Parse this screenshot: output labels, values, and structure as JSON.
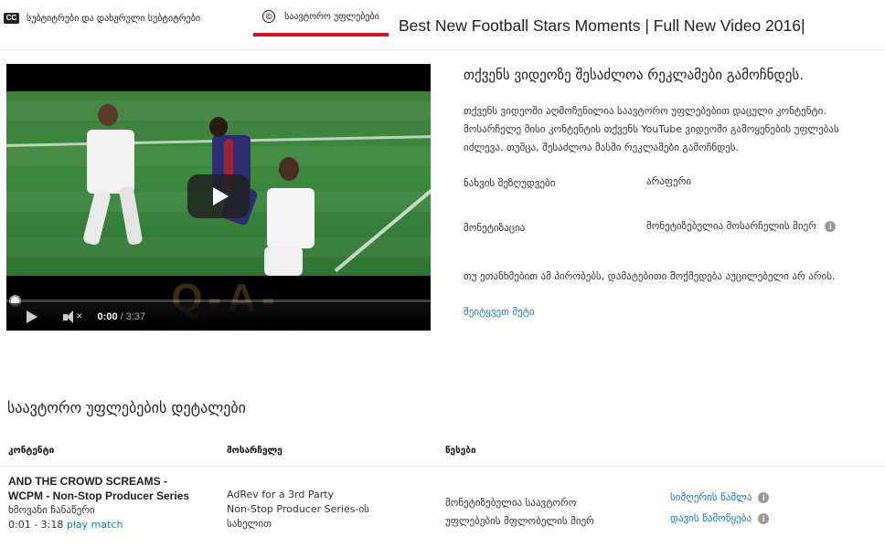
{
  "tabs": {
    "cc_badge": "CC",
    "subtitles_label": "სუბტიტრები და დახურული სუბტიტრები",
    "copyright_symbol": "©",
    "copyright_label": "საავტორო უფლებები"
  },
  "video_title": "Best New Football Stars Moments | Full New Video 2016|",
  "player": {
    "watermark": "Q-A-STUDIO",
    "current_time": "0:00",
    "separator": " / ",
    "duration": "3:37",
    "progress_fraction": 0.0
  },
  "info": {
    "heading": "თქვენს ვიდეოზე შესაძლოა რეკლამები გამოჩნდეს.",
    "paragraph": "თქვენს ვიდეოში აღმოჩენილია საავტორო უფლებებით დაცული კონტენტი. მოსარჩელე მისი კონტენტის თქვენს YouTube ვიდეოში გამოყენების უფლებას იძლევა. თუმცა, შესაძლოა მასში რეკლამები გამოჩნდეს.",
    "restrictions_label": "ნახვის შეზღუდვები",
    "restrictions_value": "არაფერი",
    "monetization_label": "მონეტიზაცია",
    "monetization_value": "მონეტიზებულია მოსარჩელის მიერ",
    "agree_text": "თუ ეთანხმებით ამ პირობებს, დამატებითი მოქმედება აუცილებელი არ არის.",
    "learn_more": "შეიტყვეთ მეტი"
  },
  "details": {
    "heading": "საავტორო უფლებების დეტალები",
    "columns": [
      "კონტენტი",
      "მოსარჩელე",
      "წესები"
    ],
    "row": {
      "content_title": "AND THE CROWD SCREAMS - WCPM - Non-Stop Producer Series",
      "content_type": "ხმოვანი ჩანაწერი",
      "time_range": "0:01 - 3:18",
      "play_match": "play match",
      "claimant": "AdRev for a 3rd Party",
      "claimant_on_behalf": "Non-Stop Producer Series-ის სახელით",
      "policy": "მონეტიზებულია საავტორო უფლებების მფლობელის მიერ",
      "action_dispute": "სიმღერის წაშლა",
      "action_dispute2": "დავის წამოწყება"
    }
  },
  "colors": {
    "accent_red": "#cc181e",
    "link_blue": "#167ac6",
    "info_icon_grey": "#999999"
  },
  "icons": {
    "cc": "closed-captions-icon",
    "copyright": "copyright-icon",
    "play": "play-icon",
    "volume": "volume-muted-icon",
    "info": "info-icon"
  }
}
